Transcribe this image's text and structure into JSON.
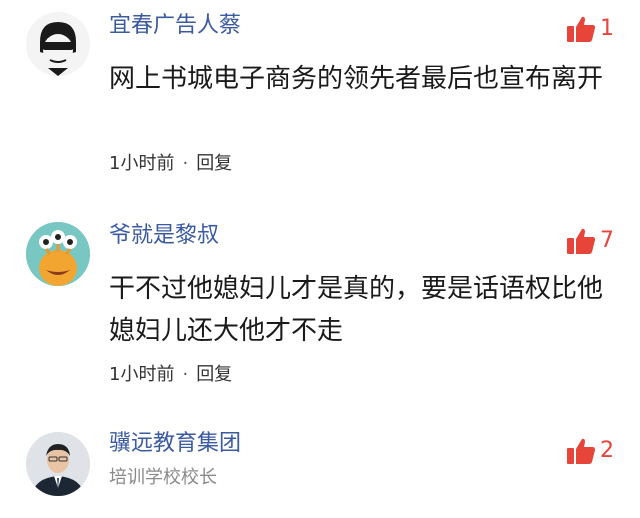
{
  "comments": [
    {
      "username": "宜春广告人蔡",
      "subtitle": "",
      "likes": "1",
      "content": "网上书城电子商务的领先者最后也宣布离开",
      "time": "1小时前",
      "reply_label": "回复"
    },
    {
      "username": "爷就是黎叔",
      "subtitle": "",
      "likes": "7",
      "content": "干不过他媳妇儿才是真的，要是话语权比他媳妇儿还大他才不走",
      "time": "1小时前",
      "reply_label": "回复"
    },
    {
      "username": "骥远教育集团",
      "subtitle": "培训学校校长",
      "likes": "2",
      "content": "",
      "time": "",
      "reply_label": ""
    }
  ],
  "colors": {
    "username": "#3b5ba0",
    "like": "#e8453a",
    "meta": "#333333",
    "subtitle": "#8a8a8a"
  }
}
